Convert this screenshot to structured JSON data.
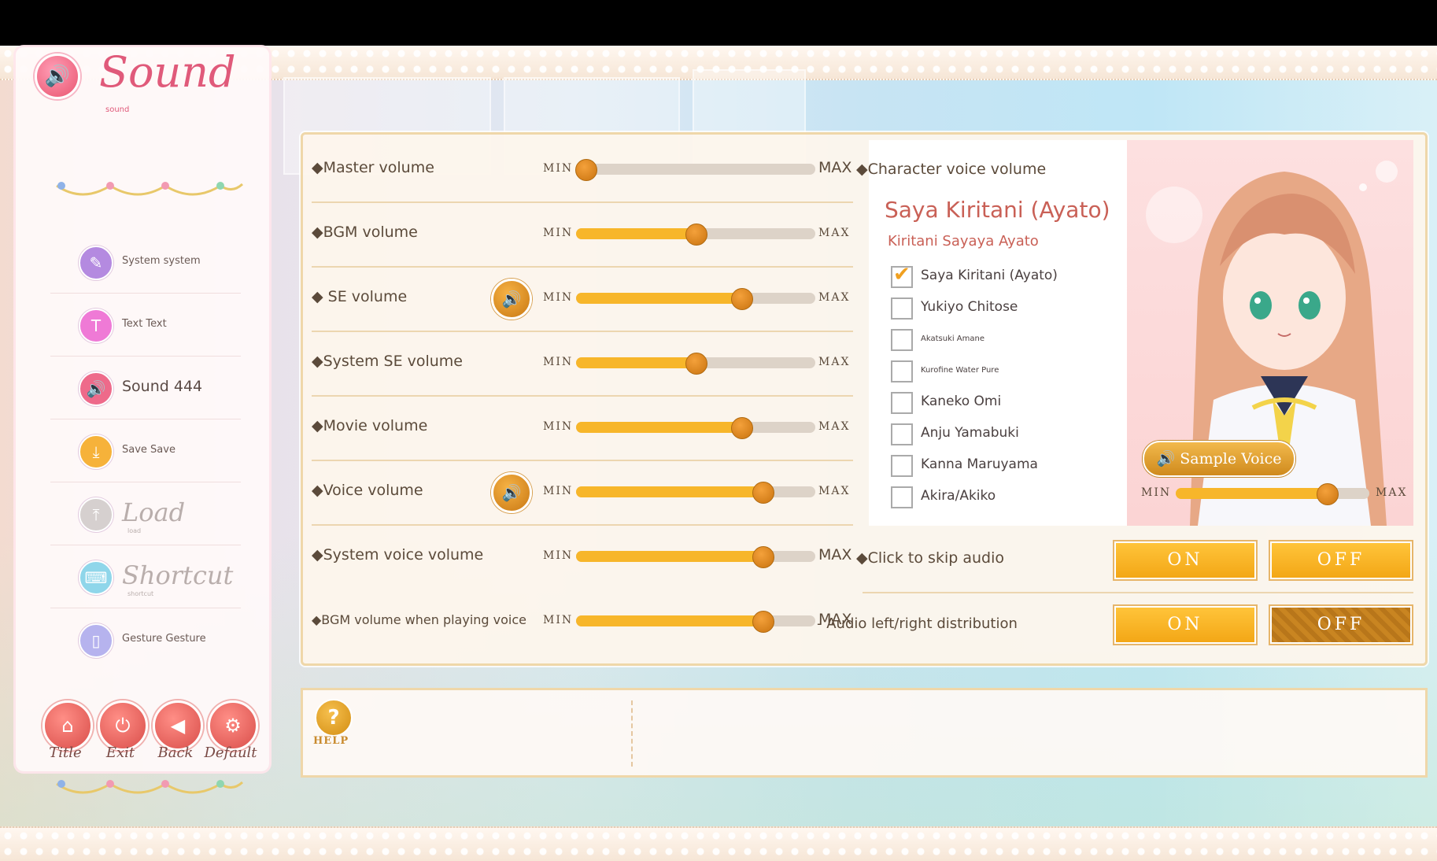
{
  "sidebar": {
    "title": "Sound",
    "subtitle": "sound",
    "items": [
      {
        "label": "System system",
        "icon": "wrench-icon",
        "color": "#b48ae0"
      },
      {
        "label": "Text Text",
        "icon": "text-icon",
        "color": "#ef7ad6"
      },
      {
        "label": "Sound 444",
        "icon": "speaker-icon",
        "color": "#ee6a8a"
      },
      {
        "label": "Save Save",
        "icon": "download-icon",
        "color": "#f6b23a"
      },
      {
        "label": "Load",
        "sub": "load",
        "icon": "upload-icon",
        "color": "#d6d0cf"
      },
      {
        "label": "Shortcut",
        "sub": "shortcut",
        "icon": "keyboard-icon",
        "color": "#8fd6ea"
      },
      {
        "label": "Gesture Gesture",
        "icon": "mouse-icon",
        "color": "#b6b3ee"
      }
    ],
    "buttons": [
      {
        "label": "Title",
        "icon": "home-icon"
      },
      {
        "label": "Exit",
        "icon": "power-icon"
      },
      {
        "label": "Back",
        "icon": "back-arrow-icon"
      },
      {
        "label": "Default",
        "icon": "gear-icon"
      }
    ]
  },
  "volumes": {
    "min_label": "MIN",
    "max_label": "MAX",
    "rows": [
      {
        "label": "◆Master volume",
        "level": 0.04
      },
      {
        "label": "◆BGM volume",
        "level": 0.5
      },
      {
        "label": "◆ SE volume",
        "level": 0.69,
        "speaker": true
      },
      {
        "label": "◆System SE volume",
        "level": 0.5
      },
      {
        "label": "◆Movie volume",
        "level": 0.69
      },
      {
        "label": "◆Voice volume",
        "level": 0.78,
        "speaker": true
      },
      {
        "label": "◆System voice volume",
        "level": 0.78
      },
      {
        "label": "◆BGM volume when playing voice",
        "level": 0.78
      }
    ]
  },
  "character_voice": {
    "heading": "◆Character voice volume",
    "selected_name": "Saya Kiritani (Ayato)",
    "selected_sub": "Kiritani Sayaya Ayato",
    "characters": [
      {
        "label": "Saya Kiritani (Ayato)",
        "checked": true
      },
      {
        "label": "Yukiyo Chitose",
        "checked": false
      },
      {
        "label": "Akatsuki Amane",
        "checked": false,
        "tiny": true
      },
      {
        "label": "Kurofine Water Pure",
        "checked": false,
        "tiny": true
      },
      {
        "label": "Kaneko Omi",
        "checked": false
      },
      {
        "label": "Anju Yamabuki",
        "checked": false
      },
      {
        "label": "Kanna Maruyama",
        "checked": false
      },
      {
        "label": "Akira/Akiko",
        "checked": false
      }
    ],
    "sample_voice_label": "Sample Voice",
    "level": 0.78
  },
  "skip_audio": {
    "label": "◆Click to skip audio",
    "on": "ON",
    "off": "OFF"
  },
  "distribution": {
    "label": "- Audio left/right distribution",
    "on": "ON",
    "off": "OFF"
  },
  "help": {
    "label": "HELP",
    "icon": "question-icon"
  },
  "colors": {
    "accent": "#f7b62a",
    "knob": "#c9730f",
    "title": "#e05a7a"
  }
}
